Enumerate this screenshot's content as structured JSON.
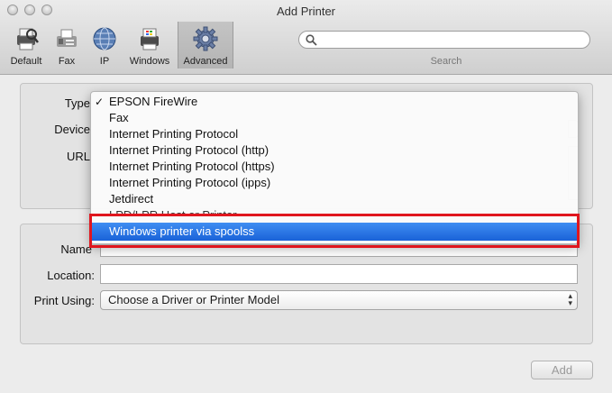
{
  "window": {
    "title": "Add Printer"
  },
  "toolbar": {
    "items": [
      {
        "label": "Default",
        "icon": "printer-magnifier-icon"
      },
      {
        "label": "Fax",
        "icon": "fax-icon"
      },
      {
        "label": "IP",
        "icon": "globe-icon"
      },
      {
        "label": "Windows",
        "icon": "windows-printer-icon"
      },
      {
        "label": "Advanced",
        "icon": "gear-icon"
      }
    ],
    "search": {
      "value": "",
      "label": "Search"
    }
  },
  "form": {
    "type_label": "Type",
    "device_label": "Device",
    "url_label": "URL",
    "name_label": "Name",
    "location_label": "Location:",
    "location_value": "",
    "print_using_label": "Print Using:",
    "print_using_value": "Choose a Driver or Printer Model"
  },
  "type_menu": {
    "items": [
      {
        "label": "EPSON FireWire",
        "checked": true
      },
      {
        "label": "Fax"
      },
      {
        "label": "Internet Printing Protocol"
      },
      {
        "label": "Internet Printing Protocol (http)"
      },
      {
        "label": "Internet Printing Protocol (https)"
      },
      {
        "label": "Internet Printing Protocol (ipps)"
      },
      {
        "label": "Jetdirect"
      },
      {
        "label": "LPD/LPR Host or Printer"
      },
      {
        "label": "Windows printer via spoolss",
        "selected": true
      }
    ],
    "check_glyph": "✓",
    "highlight_color": "#e0161e",
    "selection_color": "#1a62d8"
  },
  "buttons": {
    "add_label": "Add"
  }
}
